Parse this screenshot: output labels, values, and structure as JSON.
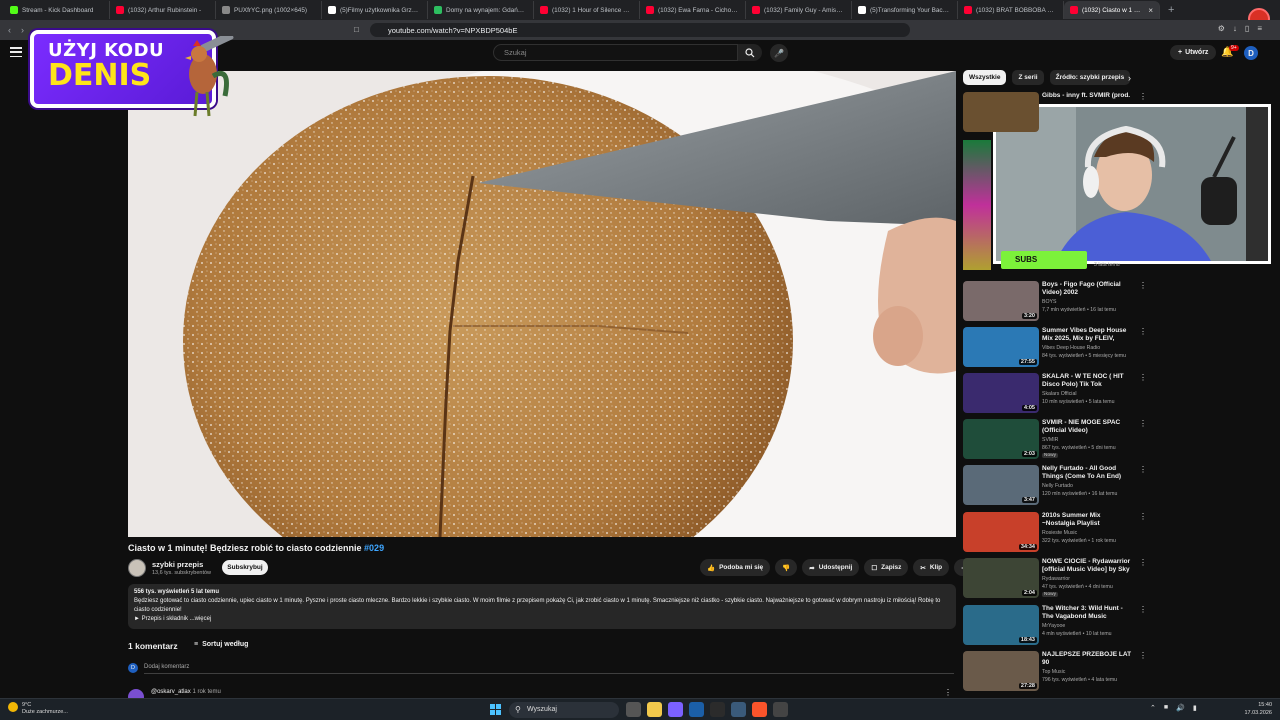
{
  "browser": {
    "tabs": [
      {
        "title": "Stream - Kick Dashboard",
        "color": "#53fc18",
        "active": false
      },
      {
        "title": "(1032) Arthur Rubinstein -",
        "color": "#ff0033",
        "active": false
      },
      {
        "title": "PUXfrYC.png (1002×645)",
        "color": "#888888",
        "active": false
      },
      {
        "title": "(5)Filmy użytkownika Grzegorz",
        "color": "#ffffff",
        "active": false
      },
      {
        "title": "Domy na wynajem: Gdańsk, p",
        "color": "#2dbe60",
        "active": false
      },
      {
        "title": "(1032) 1 Hour of Silence Occe",
        "color": "#ff0033",
        "active": false
      },
      {
        "title": "(1032) Ewa Farna - Cicho HOO",
        "color": "#ff0033",
        "active": false
      },
      {
        "title": "(1032) Family Guy - Amish Ba",
        "color": "#ff0033",
        "active": false
      },
      {
        "title": "(5)Transforming Your Backyard",
        "color": "#ffffff",
        "active": false
      },
      {
        "title": "(1032) BRAT BOBBOBA PYTA",
        "color": "#ff0033",
        "active": false
      },
      {
        "title": "(1032) Ciasto w 1 minutę",
        "color": "#ff0033",
        "active": true
      }
    ],
    "url": "youtube.com/watch?v=NPXBDP504bE"
  },
  "youtube": {
    "search_placeholder": "Szukaj",
    "create_label": "Utwórz",
    "notif_count": "9+",
    "avatar_letter": "D"
  },
  "promo": {
    "line1": "UŻYJ KODU",
    "line2": "DENIS"
  },
  "video": {
    "title": "Ciasto w 1 minutę! Będziesz robić to ciasto codziennie ",
    "hashtag": "#029",
    "channel": "szybki przepis",
    "subs": "13,6 tys. subskrybentów",
    "subscribe": "Subskrybuj",
    "actions": {
      "like": "Podoba mi się",
      "share": "Udostępnij",
      "save": "Zapisz",
      "clip": "Klip"
    },
    "desc_meta": "556 tys. wyświetleń  5 lat temu",
    "desc_text": "Będziesz gotować to ciasto codziennie, upiec ciasto w 1 minutę. Pyszne i proste ciasto mleczne. Bardzo lekkie i szybkie ciasto. W moim filmie z przepisem pokażę Ci, jak zrobić ciasto w 1 minutę. Smaczniejsze niż ciastko - szybkie ciasto. Najważniejsze to gotować w dobrym nastroju iz miłością! Robię to ciasto codziennie!",
    "desc_more_lead": "► Przepis i składnik",
    "desc_more": "...więcej"
  },
  "comments": {
    "count_label": "1 komentarz",
    "sort_label": "Sortuj według",
    "avatar_letter": "D",
    "add_placeholder": "Dodaj komentarz",
    "first_author": "@oskarv_atlax",
    "first_time": "1 rok temu"
  },
  "sidebar": {
    "chips": [
      "Wszystkie",
      "Z serii",
      "Źródło: szybki przepis"
    ],
    "first": {
      "title": "Gibbs - inny ft. SVMIR (prod.",
      "meta": "3 lata temu"
    },
    "items": [
      {
        "title": "Boys - Figo Fago (Official Video) 2002",
        "channel": "BOYS",
        "meta": "7,7 mln wyświetleń • 16 lat temu",
        "duration": "3:20",
        "badge": "",
        "thumb": "#7a6a6a"
      },
      {
        "title": "Summer Vibes Deep House Mix 2025, Mix by FLEIV, Summer ...",
        "channel": "Vibes Deep House Radio",
        "meta": "84 tys. wyświetleń • 5 miesięcy temu",
        "duration": "27:55",
        "badge": "",
        "thumb": "#2b79b5"
      },
      {
        "title": "SKALAR - W TE NOC ( HIT Disco Polo) Tik Tok",
        "channel": "Skalars Official",
        "meta": "10 mln wyświetleń • 5 lata temu",
        "duration": "4:05",
        "badge": "",
        "thumb": "#3a2a6e"
      },
      {
        "title": "SVMIR - NIE MOGE SPAĆ (Official Video)",
        "channel": "SVMIR",
        "meta": "867 tys. wyświetleń • 5 dni temu",
        "duration": "2:03",
        "badge": "Nowy",
        "thumb": "#1f4d3a"
      },
      {
        "title": "Nelly Furtado - All Good Things (Come To An End) (US Version...",
        "channel": "Nelly Furtado",
        "meta": "120 mln wyświetleń • 16 lat temu",
        "duration": "3:47",
        "badge": "",
        "thumb": "#5a6a78"
      },
      {
        "title": "2010s Summer Mix ~Nostalgia Playlist",
        "channel": "Rosieste Music",
        "meta": "322 tys. wyświetleń • 1 rok temu",
        "duration": "34:34",
        "badge": "",
        "thumb": "#c8402a"
      },
      {
        "title": "NOWE CIOCIE - Rydawarrior [official Music Video] by Sky ...",
        "channel": "Rydawarrior",
        "meta": "47 tys. wyświetleń • 4 dni temu",
        "duration": "2:04",
        "badge": "Nowy",
        "thumb": "#3d4535"
      },
      {
        "title": "The Witcher 3: Wild Hunt - The Vagabond Music Extended",
        "channel": "MrYayooe",
        "meta": "4 mln wyświetleń • 10 lat temu",
        "duration": "18:43",
        "badge": "",
        "thumb": "#2a6b8a"
      },
      {
        "title": "NAJLEPSZE PRZEBOJE LAT 90",
        "channel": "Top Music",
        "meta": "796 tys. wyświetleń • 4 lata temu",
        "duration": "27:28",
        "badge": "",
        "thumb": "#6a5a4a"
      }
    ]
  },
  "overlay": {
    "subs_label": "SUBS"
  },
  "taskbar": {
    "temp": "9°C",
    "weather": "Duże zachmurze...",
    "search": "Wyszukaj",
    "time": "15:40",
    "date": "17.03.2026"
  }
}
